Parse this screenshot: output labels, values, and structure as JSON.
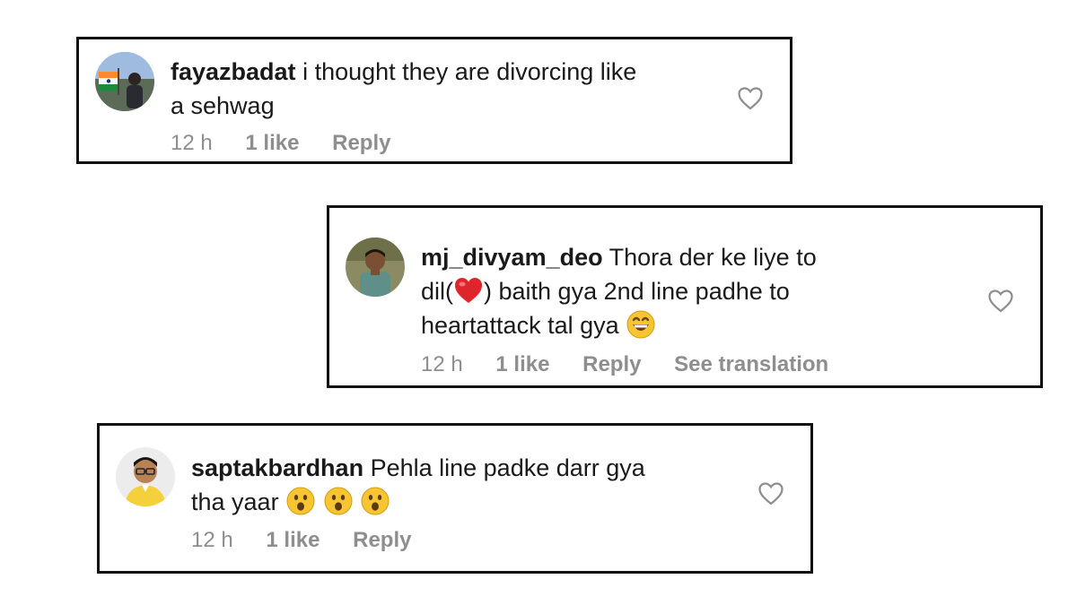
{
  "comments": [
    {
      "username": "fayazbadat",
      "text_line1": "i thought they are divorcing like",
      "text_line2": "a sehwag",
      "time": "12 h",
      "likes": "1 like",
      "reply": "Reply",
      "like_icon": "heart-outline-icon",
      "avatar_icon": "flag-avatar"
    },
    {
      "username": "mj_divyam_deo",
      "text_line1": "Thora der ke liye to",
      "text_line2_pre": "dil(",
      "emoji_heart": "❤️",
      "text_line2_post": ") baith gya 2nd line padhe to",
      "text_line3": "heartattack tal gya",
      "emoji_grin": "😄",
      "time": "12 h",
      "likes": "1 like",
      "reply": "Reply",
      "translation": "See translation",
      "like_icon": "heart-outline-icon",
      "avatar_icon": "person-avatar"
    },
    {
      "username": "saptakbardhan",
      "text_line1": "Pehla line padke darr gya",
      "text_line2": "tha yaar",
      "emoji_wow": "😮",
      "time": "12 h",
      "likes": "1 like",
      "reply": "Reply",
      "like_icon": "heart-outline-icon",
      "avatar_icon": "person-glasses-avatar"
    }
  ],
  "colors": {
    "text": "#1a1a1a",
    "meta": "#8e8e8e",
    "border": "#111111"
  }
}
